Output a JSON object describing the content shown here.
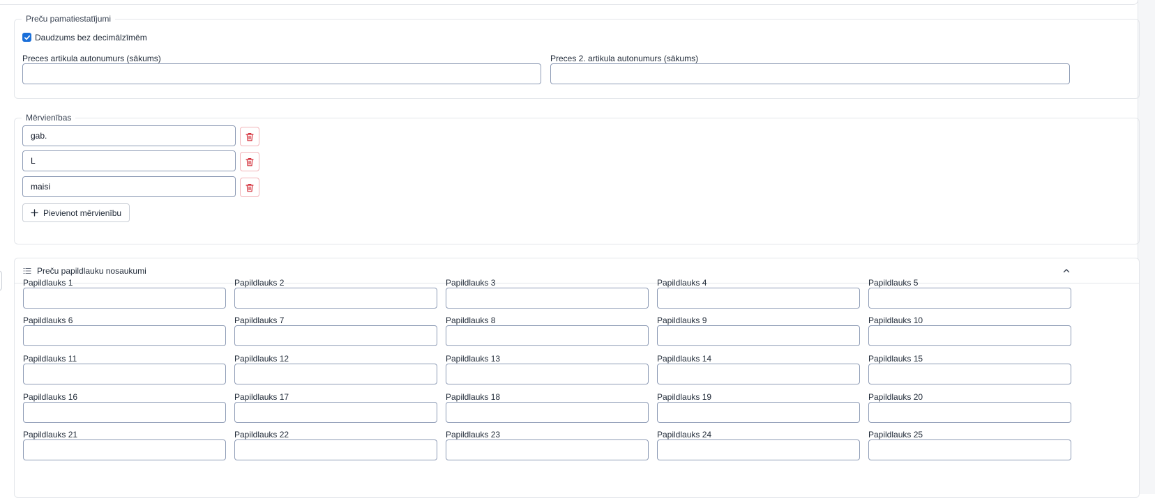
{
  "basic_settings": {
    "legend": "Preču pamatiestatījumi",
    "checkbox_label": "Daudzums bez decimālzīmēm",
    "checkbox_checked": true,
    "autonumber_label": "Preces artikula autonumurs (sākums)",
    "autonumber_value": "",
    "autonumber2_label": "Preces 2. artikula autonumurs (sākums)",
    "autonumber2_value": ""
  },
  "units": {
    "legend": "Mērvienības",
    "items": [
      {
        "value": "gab."
      },
      {
        "value": "L"
      },
      {
        "value": "maisi"
      }
    ],
    "add_label": "Pievienot mērvienību"
  },
  "extra_fields": {
    "title": "Preču papildlauku nosaukumi",
    "expanded": true,
    "fields": [
      {
        "label": "Papildlauks 1",
        "value": ""
      },
      {
        "label": "Papildlauks 2",
        "value": ""
      },
      {
        "label": "Papildlauks 3",
        "value": ""
      },
      {
        "label": "Papildlauks 4",
        "value": ""
      },
      {
        "label": "Papildlauks 5",
        "value": ""
      },
      {
        "label": "Papildlauks 6",
        "value": ""
      },
      {
        "label": "Papildlauks 7",
        "value": ""
      },
      {
        "label": "Papildlauks 8",
        "value": ""
      },
      {
        "label": "Papildlauks 9",
        "value": ""
      },
      {
        "label": "Papildlauks 10",
        "value": ""
      },
      {
        "label": "Papildlauks 11",
        "value": ""
      },
      {
        "label": "Papildlauks 12",
        "value": ""
      },
      {
        "label": "Papildlauks 13",
        "value": ""
      },
      {
        "label": "Papildlauks 14",
        "value": ""
      },
      {
        "label": "Papildlauks 15",
        "value": ""
      },
      {
        "label": "Papildlauks 16",
        "value": ""
      },
      {
        "label": "Papildlauks 17",
        "value": ""
      },
      {
        "label": "Papildlauks 18",
        "value": ""
      },
      {
        "label": "Papildlauks 19",
        "value": ""
      },
      {
        "label": "Papildlauks 20",
        "value": ""
      },
      {
        "label": "Papildlauks 21",
        "value": ""
      },
      {
        "label": "Papildlauks 22",
        "value": ""
      },
      {
        "label": "Papildlauks 23",
        "value": ""
      },
      {
        "label": "Papildlauks 24",
        "value": ""
      },
      {
        "label": "Papildlauks 25",
        "value": ""
      }
    ]
  },
  "icons": {
    "check": "check-icon",
    "delete": "trash-icon",
    "add": "plus-icon",
    "list": "list-icon",
    "collapse": "chevron-up-icon"
  },
  "colors": {
    "accent": "#1a6fd9",
    "danger": "#d32f3a",
    "input_border": "#8d9bb5"
  }
}
